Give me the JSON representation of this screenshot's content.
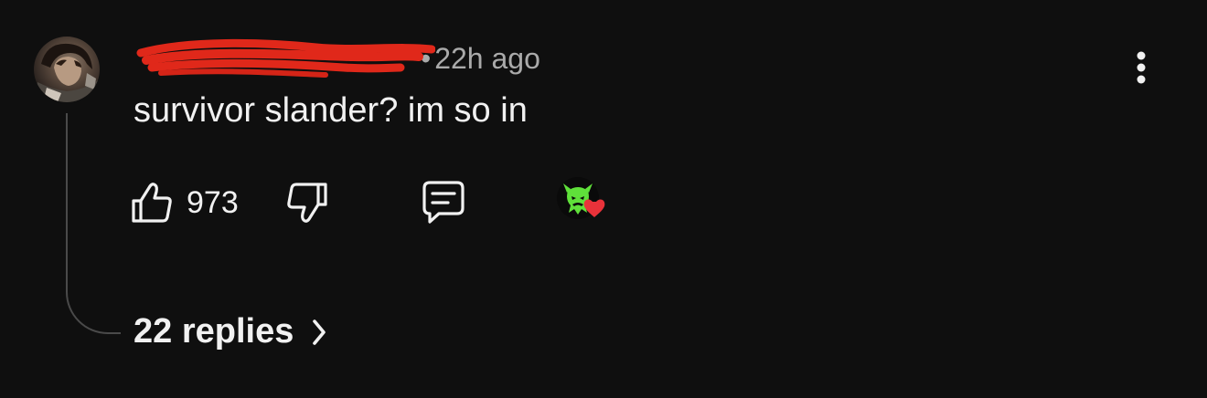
{
  "comment": {
    "author_handle": "@",
    "separator": "•",
    "timestamp": "22h ago",
    "text": "survivor slander? im so in",
    "like_count": "973",
    "replies_label": "22 replies"
  },
  "colors": {
    "background": "#0f0f0f",
    "primary_text": "#f1f1f1",
    "secondary_text": "#aaaaaa",
    "redaction": "#e0281a",
    "heart": "#e9323a",
    "creator_avatar_green": "#5fe03a"
  },
  "icons": {
    "avatar": "user-avatar",
    "more": "vertical-dots-icon",
    "like": "thumbs-up-icon",
    "dislike": "thumbs-down-icon",
    "reply": "comment-bubble-icon",
    "hearted": "creator-heart-icon",
    "expand": "chevron-right-icon"
  }
}
